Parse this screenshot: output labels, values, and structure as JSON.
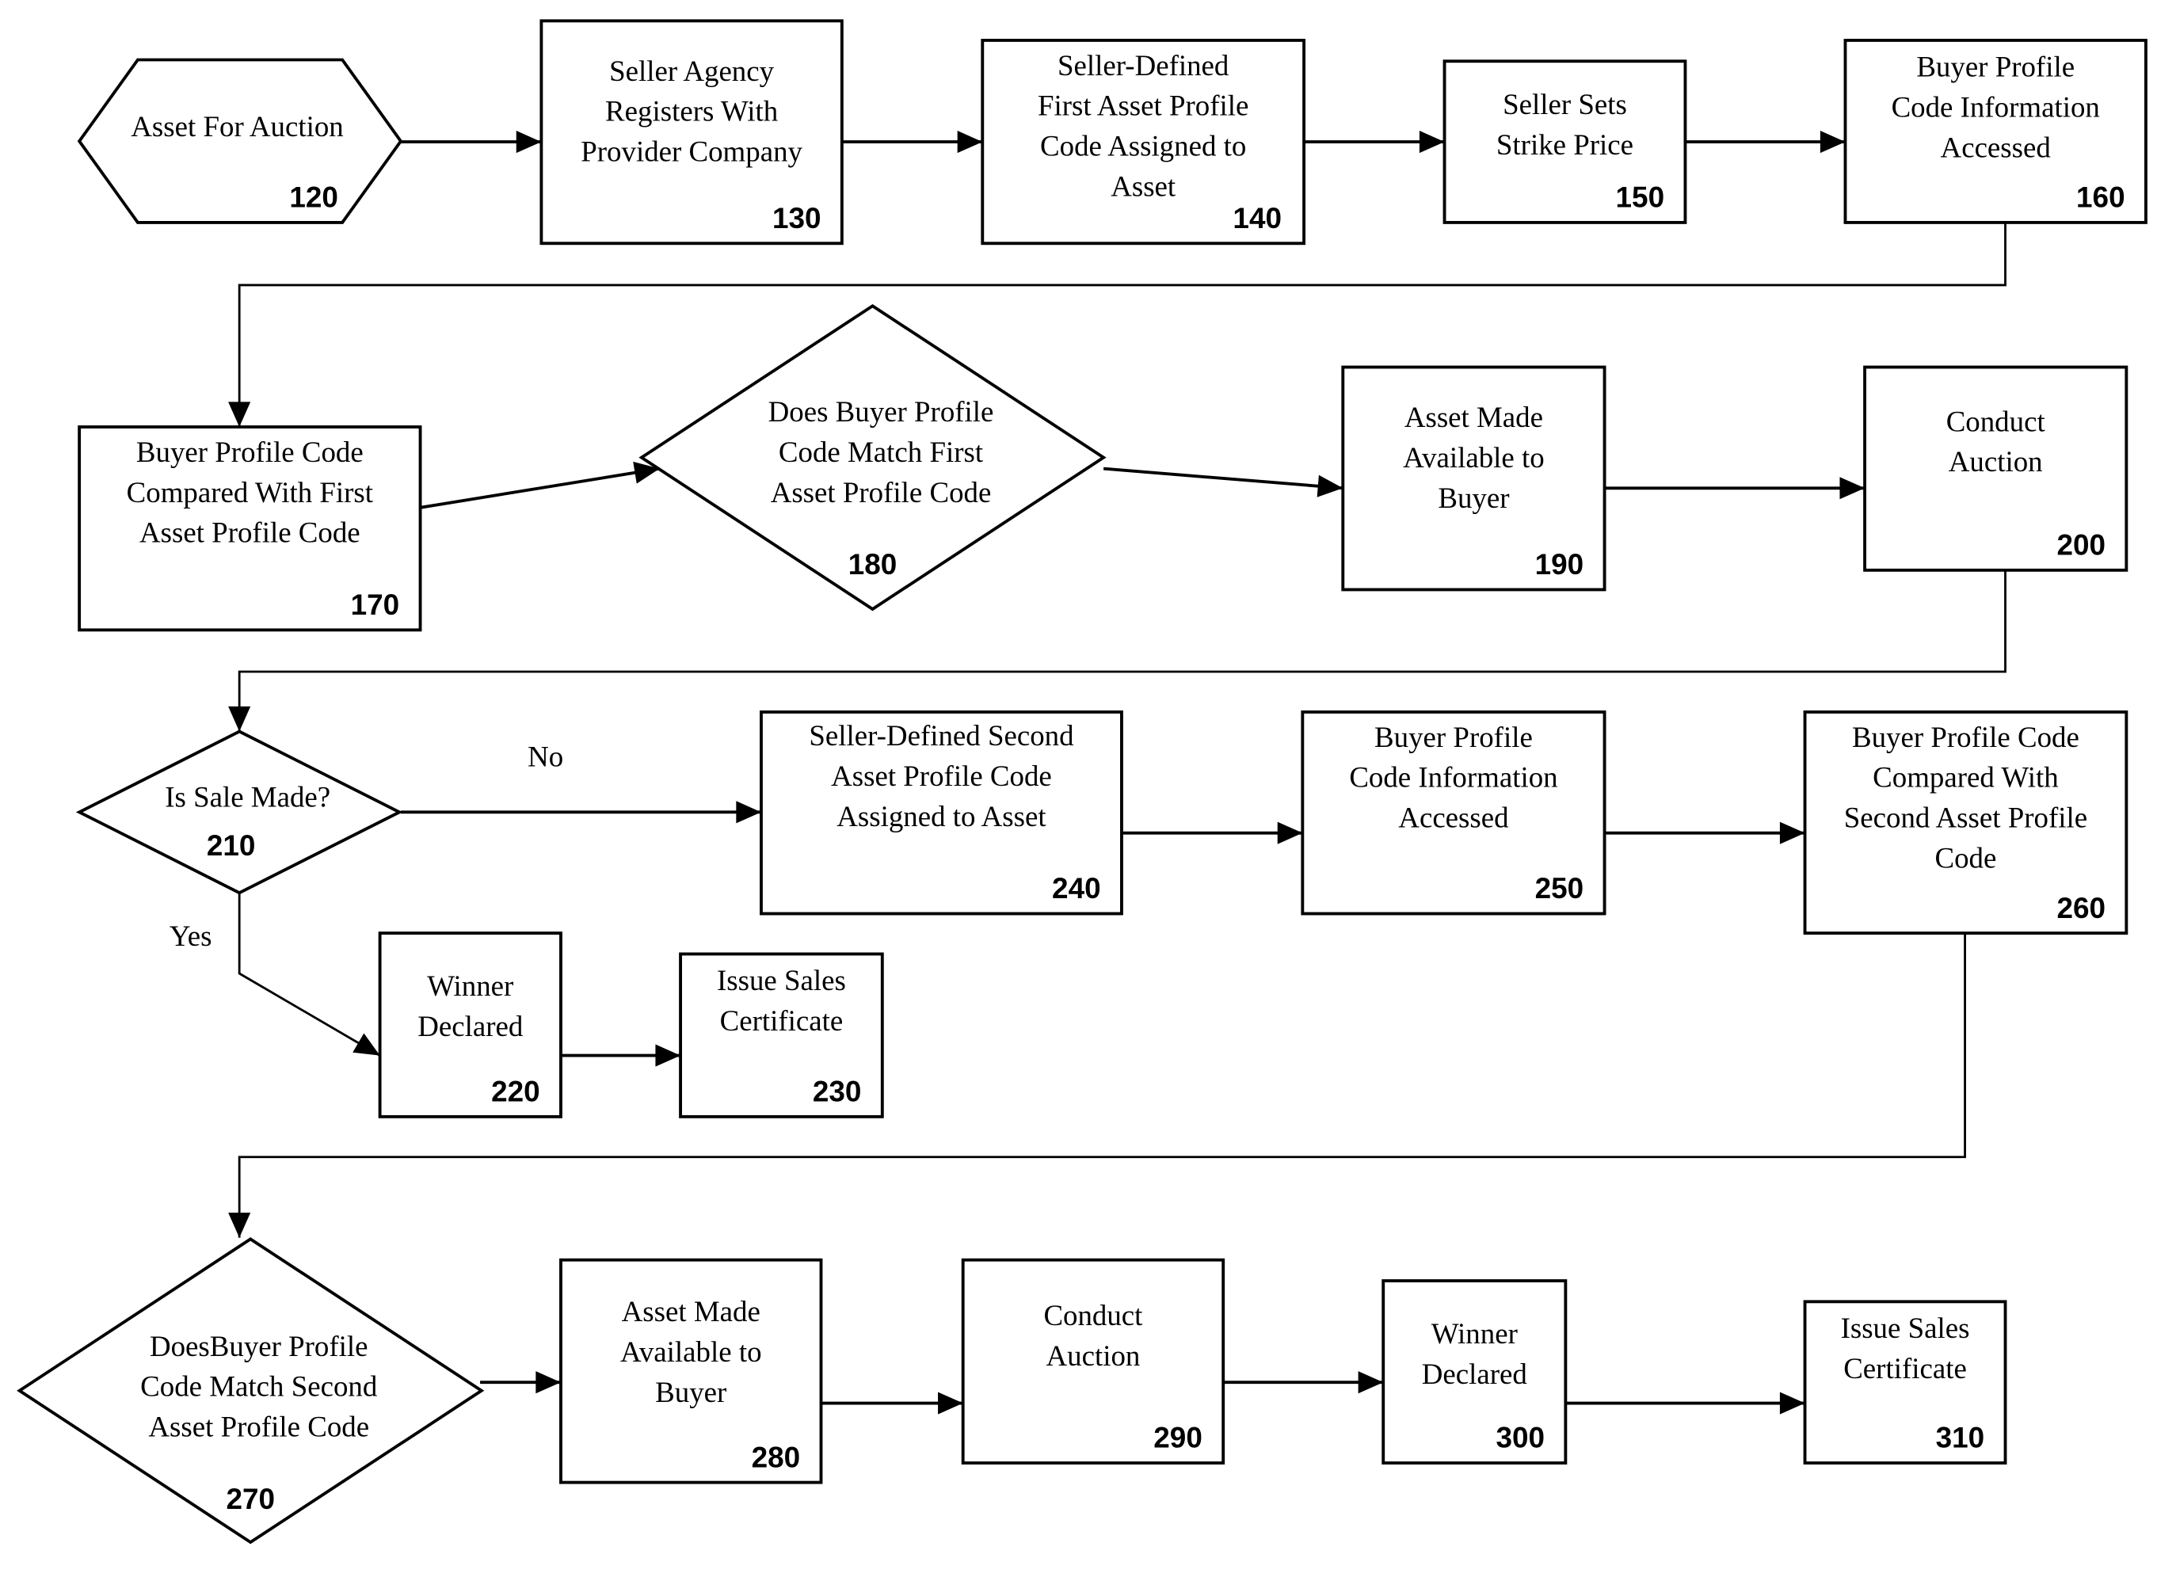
{
  "diagram": {
    "type": "flowchart",
    "nodes": [
      {
        "id": "120",
        "shape": "hexagon",
        "lines": [
          "Asset For Auction"
        ],
        "number": "120"
      },
      {
        "id": "130",
        "shape": "rect",
        "lines": [
          "Seller Agency",
          "Registers With",
          "Provider Company"
        ],
        "number": "130"
      },
      {
        "id": "140",
        "shape": "rect",
        "lines": [
          "Seller-Defined",
          "First Asset Profile",
          "Code Assigned to",
          "Asset"
        ],
        "number": "140"
      },
      {
        "id": "150",
        "shape": "rect",
        "lines": [
          "Seller Sets",
          "Strike Price"
        ],
        "number": "150"
      },
      {
        "id": "160",
        "shape": "rect",
        "lines": [
          "Buyer Profile",
          "Code Information",
          "Accessed"
        ],
        "number": "160"
      },
      {
        "id": "170",
        "shape": "rect",
        "lines": [
          "Buyer Profile Code",
          "Compared With First",
          "Asset Profile Code"
        ],
        "number": "170"
      },
      {
        "id": "180",
        "shape": "diamond",
        "lines": [
          "Does Buyer Profile",
          "Code Match First",
          "Asset Profile Code"
        ],
        "number": "180"
      },
      {
        "id": "190",
        "shape": "rect",
        "lines": [
          "Asset Made",
          "Available to",
          "Buyer"
        ],
        "number": "190"
      },
      {
        "id": "200",
        "shape": "rect",
        "lines": [
          "Conduct",
          "Auction"
        ],
        "number": "200"
      },
      {
        "id": "210",
        "shape": "diamond",
        "lines": [
          "Is Sale Made?"
        ],
        "number": "210"
      },
      {
        "id": "220",
        "shape": "rect",
        "lines": [
          "Winner",
          "Declared"
        ],
        "number": "220"
      },
      {
        "id": "230",
        "shape": "rect",
        "lines": [
          "Issue Sales",
          "Certificate"
        ],
        "number": "230"
      },
      {
        "id": "240",
        "shape": "rect",
        "lines": [
          "Seller-Defined Second",
          "Asset Profile Code",
          "Assigned to Asset"
        ],
        "number": "240"
      },
      {
        "id": "250",
        "shape": "rect",
        "lines": [
          "Buyer Profile",
          "Code Information",
          "Accessed"
        ],
        "number": "250"
      },
      {
        "id": "260",
        "shape": "rect",
        "lines": [
          "Buyer Profile Code",
          "Compared With",
          "Second Asset Profile",
          "Code"
        ],
        "number": "260"
      },
      {
        "id": "270",
        "shape": "diamond",
        "lines": [
          "DoesBuyer Profile",
          "Code Match Second",
          "Asset Profile Code"
        ],
        "number": "270"
      },
      {
        "id": "280",
        "shape": "rect",
        "lines": [
          "Asset Made",
          "Available to",
          "Buyer"
        ],
        "number": "280"
      },
      {
        "id": "290",
        "shape": "rect",
        "lines": [
          "Conduct",
          "Auction"
        ],
        "number": "290"
      },
      {
        "id": "300",
        "shape": "rect",
        "lines": [
          "Winner",
          "Declared"
        ],
        "number": "300"
      },
      {
        "id": "310",
        "shape": "rect",
        "lines": [
          "Issue Sales",
          "Certificate"
        ],
        "number": "310"
      }
    ],
    "edges": [
      {
        "from": "120",
        "to": "130",
        "label": ""
      },
      {
        "from": "130",
        "to": "140",
        "label": ""
      },
      {
        "from": "140",
        "to": "150",
        "label": ""
      },
      {
        "from": "150",
        "to": "160",
        "label": ""
      },
      {
        "from": "160",
        "to": "170",
        "label": ""
      },
      {
        "from": "170",
        "to": "180",
        "label": ""
      },
      {
        "from": "180",
        "to": "190",
        "label": ""
      },
      {
        "from": "190",
        "to": "200",
        "label": ""
      },
      {
        "from": "200",
        "to": "210",
        "label": ""
      },
      {
        "from": "210",
        "to": "240",
        "label": "No"
      },
      {
        "from": "210",
        "to": "220",
        "label": "Yes"
      },
      {
        "from": "220",
        "to": "230",
        "label": ""
      },
      {
        "from": "240",
        "to": "250",
        "label": ""
      },
      {
        "from": "250",
        "to": "260",
        "label": ""
      },
      {
        "from": "260",
        "to": "270",
        "label": ""
      },
      {
        "from": "270",
        "to": "280",
        "label": ""
      },
      {
        "from": "280",
        "to": "290",
        "label": ""
      },
      {
        "from": "290",
        "to": "300",
        "label": ""
      },
      {
        "from": "300",
        "to": "310",
        "label": ""
      }
    ]
  }
}
